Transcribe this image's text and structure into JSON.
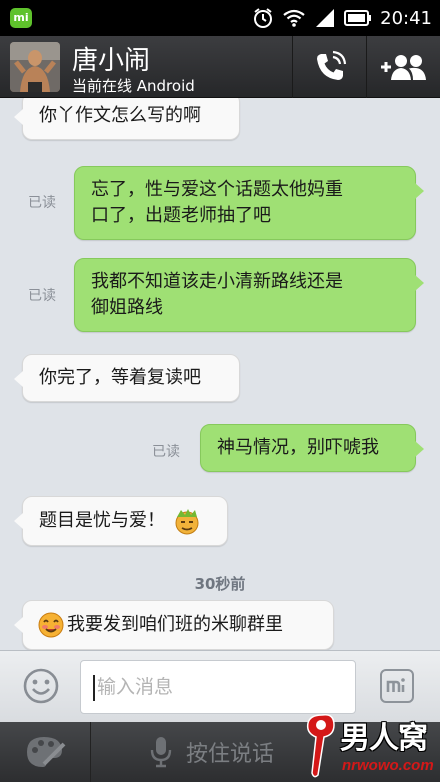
{
  "status_bar": {
    "badge": "mi",
    "time": "20:41"
  },
  "header": {
    "contact_name": "唐小闹",
    "contact_status": "当前在线 Android"
  },
  "messages": [
    {
      "direction": "in",
      "text": "你丫作文怎么写的啊"
    },
    {
      "direction": "out",
      "read": "已读",
      "line1": "忘了，性与爱这个话题太他妈重",
      "line2": "口了，出题老师抽了吧"
    },
    {
      "direction": "out",
      "read": "已读",
      "line1": "我都不知道该走小清新路线还是",
      "line2": "御姐路线"
    },
    {
      "direction": "in",
      "text": "你完了，等着复读吧"
    },
    {
      "direction": "out",
      "read": "已读",
      "text": "神马情况，别吓唬我"
    },
    {
      "direction": "in",
      "text": "题目是忧与爱！",
      "emoji": "zombie-face-emoji"
    },
    {
      "direction": "in",
      "text": "我要发到咱们班的米聊群里",
      "emoji": "smiling-face-emoji"
    }
  ],
  "time_divider": "30秒前",
  "input": {
    "placeholder": "输入消息"
  },
  "bottom_bar": {
    "hold_to_talk": "按住说话"
  },
  "watermark": {
    "site_name": "男人窝",
    "url": "nrwowo.com"
  },
  "colors": {
    "status_bar": "#000000",
    "header": "#2e2f31",
    "chat_background": "#dfe3e8",
    "incoming_bubble": "#f9f9f9",
    "outgoing_bubble": "#9fe074",
    "mi_badge": "#5fc22c"
  }
}
